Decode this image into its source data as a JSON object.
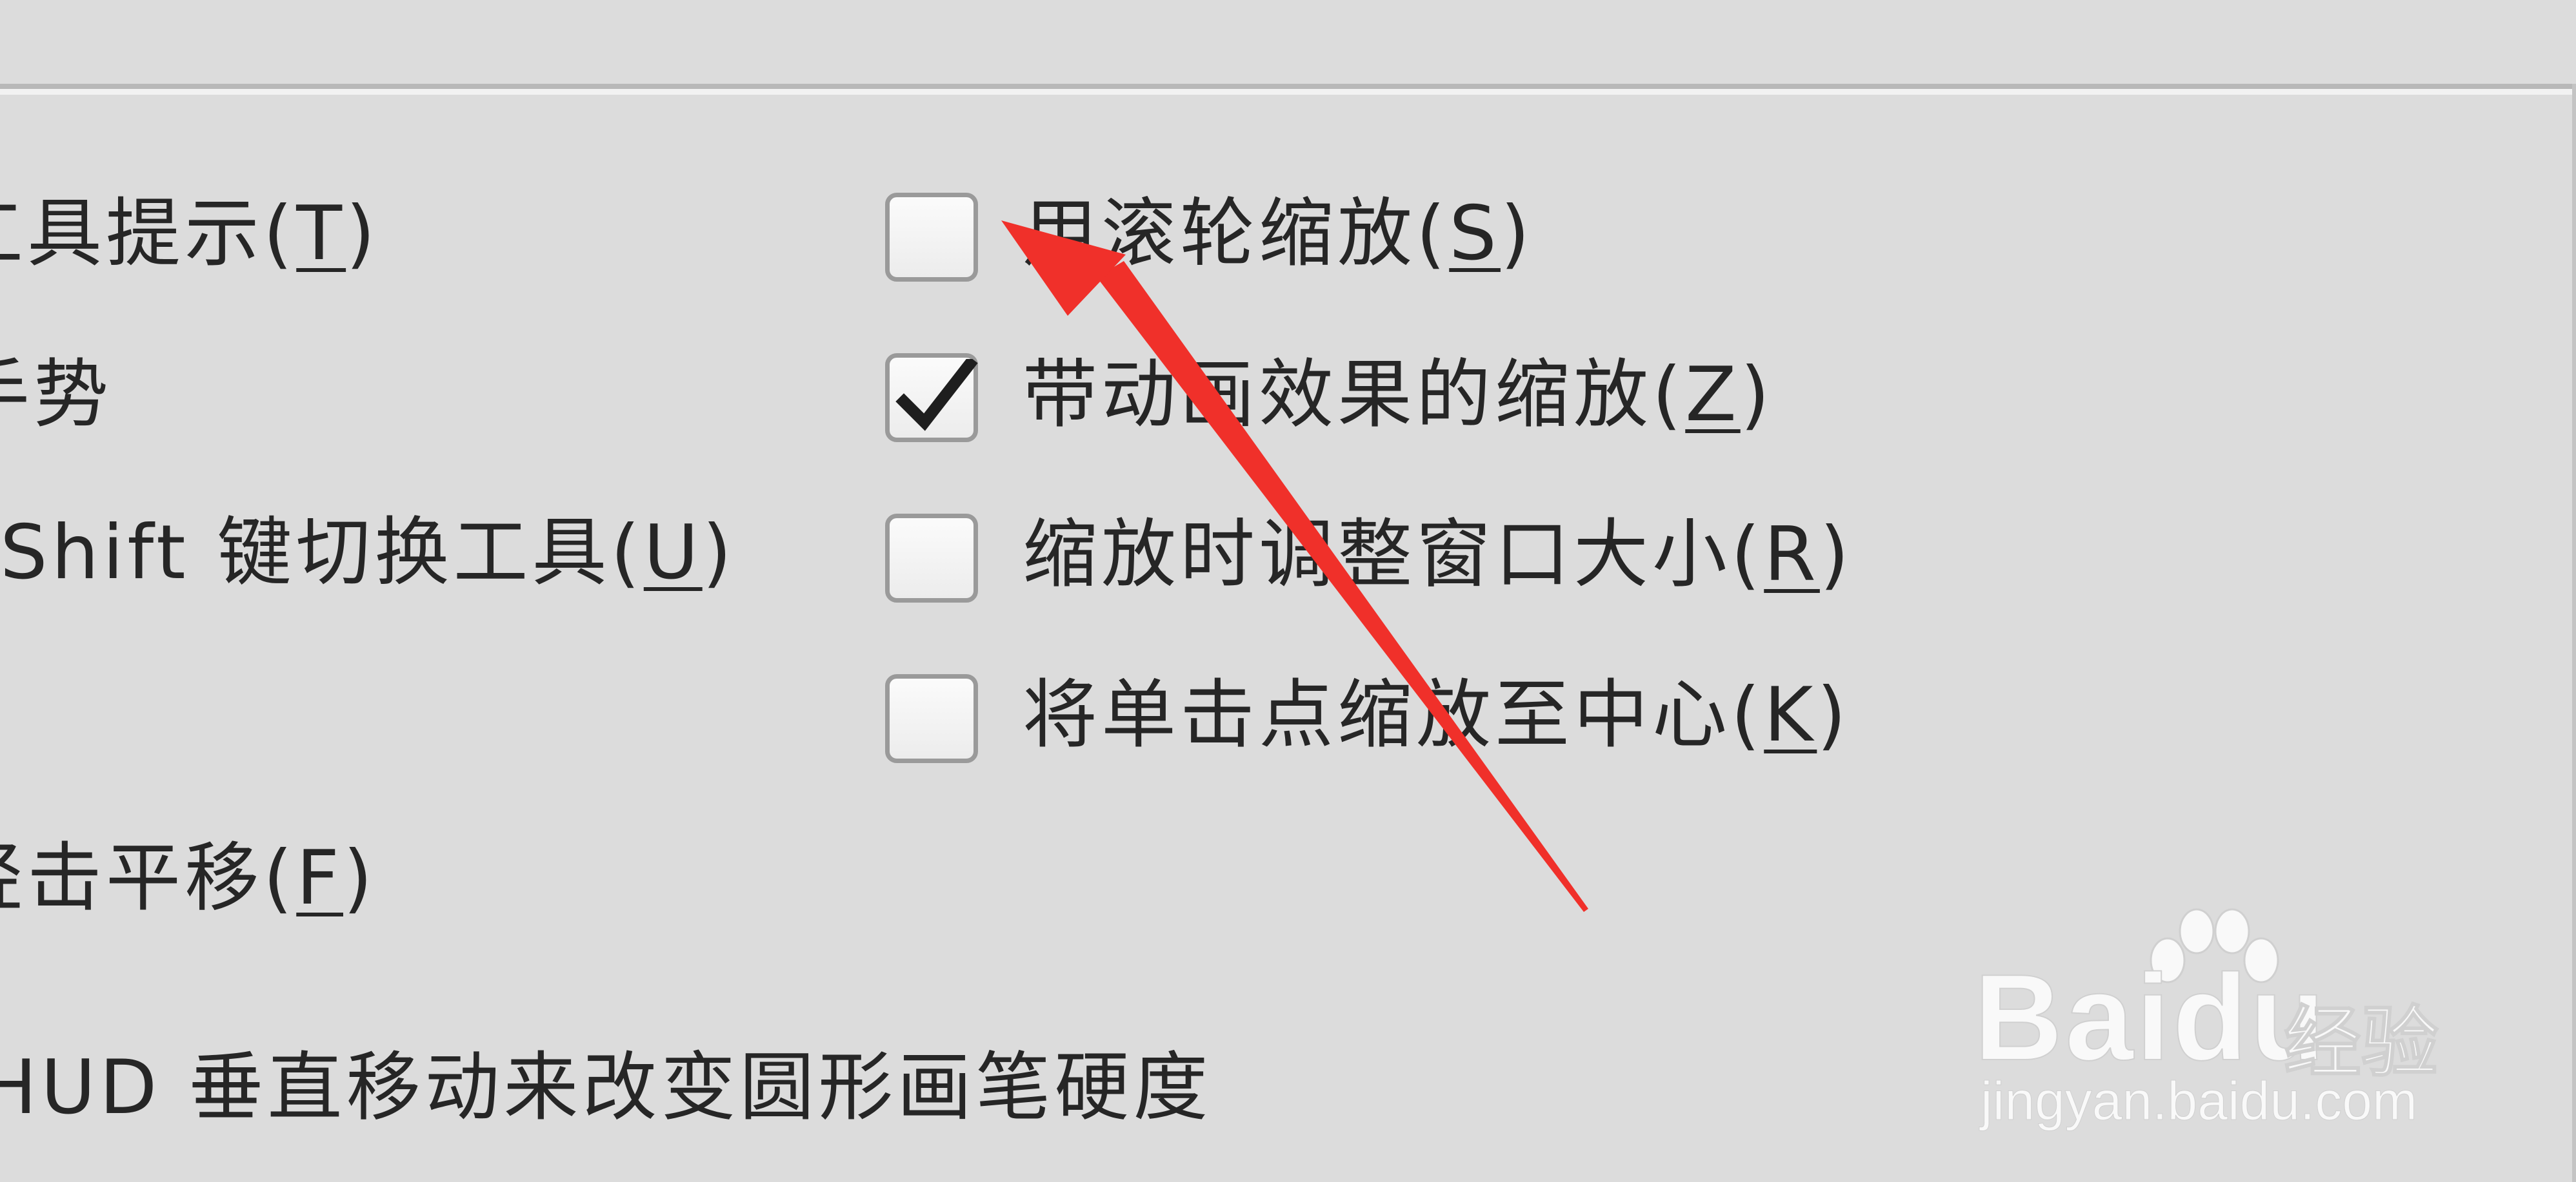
{
  "left_column": {
    "tooltips": {
      "text": "工具提示(",
      "key": "T",
      "end": ")"
    },
    "gesture": {
      "text": "手势"
    },
    "shift_switch": {
      "text": "Shift 键切换工具(",
      "key": "U",
      "end": ")"
    },
    "flick_pan": {
      "text": "轻击平移(",
      "key": "F",
      "end": ")"
    },
    "hud": {
      "text": "HUD 垂直移动来改变圆形画笔硬度"
    }
  },
  "right_column": {
    "zoom_scroll": {
      "text": "用滚轮缩放(",
      "key": "S",
      "end": ")",
      "checked": false
    },
    "animated_zoom": {
      "text": "带动画效果的缩放(",
      "key": "Z",
      "end": ")",
      "checked": true
    },
    "zoom_resize": {
      "text": "缩放时调整窗口大小(",
      "key": "R",
      "end": ")",
      "checked": false
    },
    "zoom_click": {
      "text": "将单击点缩放至中心(",
      "key": "K",
      "end": ")",
      "checked": false
    }
  },
  "watermark": {
    "brand": "Bai",
    "brand2": "du",
    "brand_cn": "经验",
    "url": "jingyan.baidu.com"
  },
  "colors": {
    "background": "#dcdcdc",
    "arrow": "#f0302a",
    "text": "#262626"
  },
  "icons": {
    "checkmark": "check-icon",
    "annotation": "red-arrow-icon",
    "watermark_logo": "baidu-paw-icon"
  }
}
